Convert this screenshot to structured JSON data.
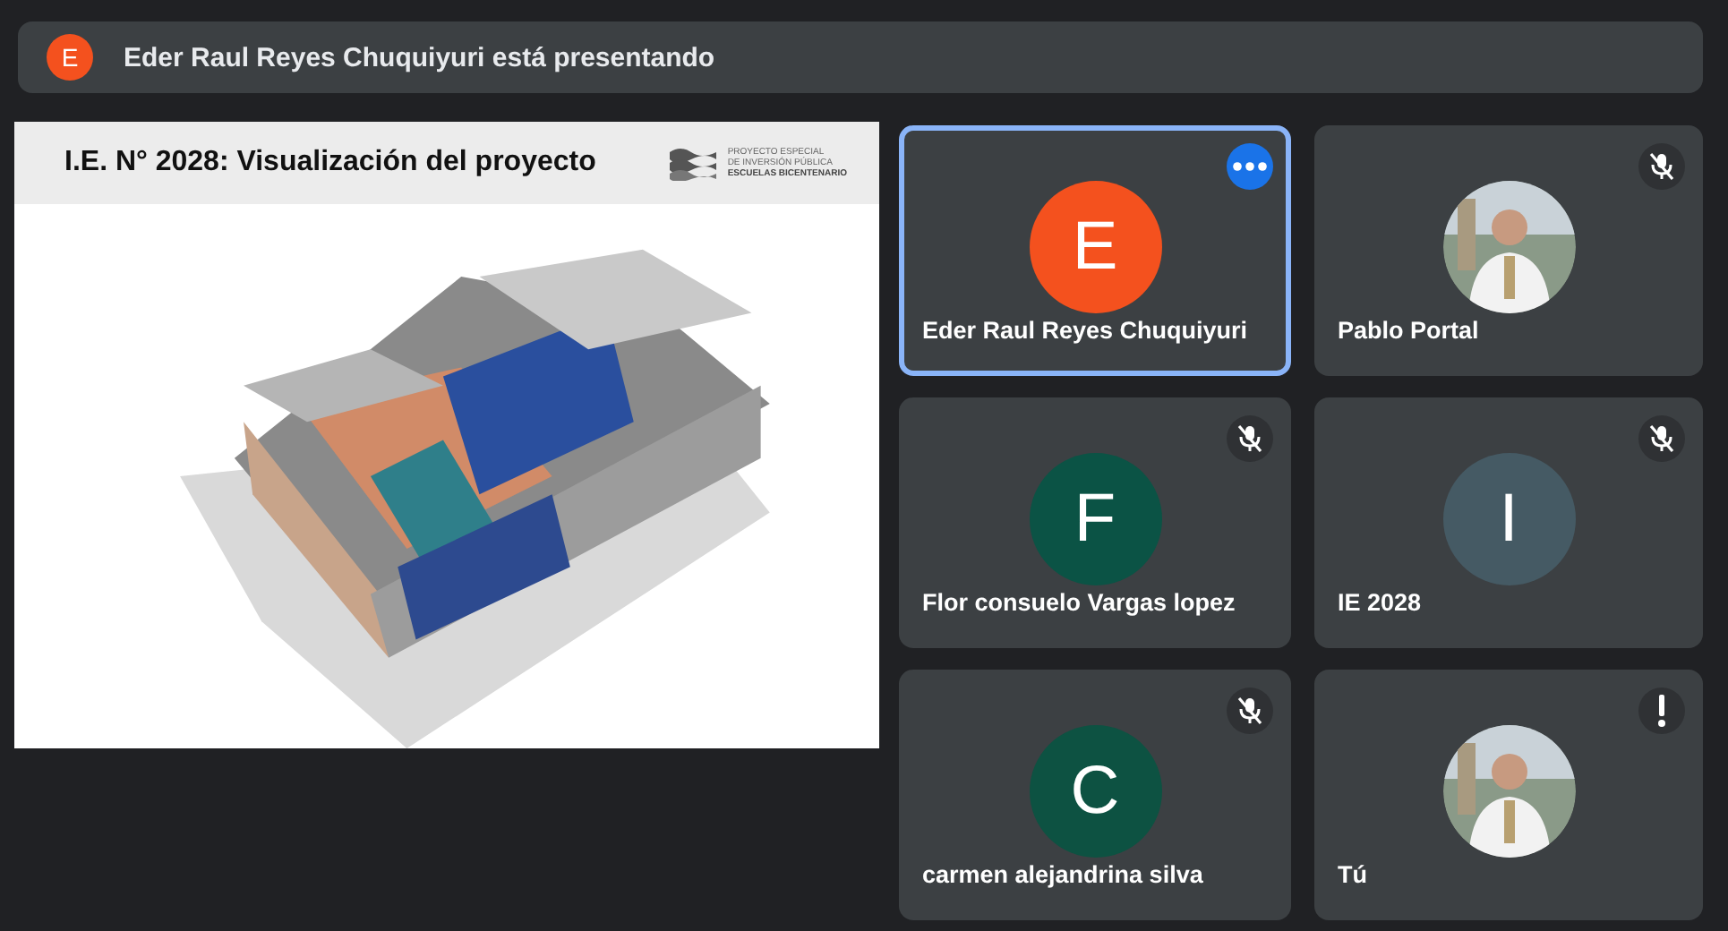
{
  "presenter_bar": {
    "initial": "E",
    "color": "#f4511e",
    "text": "Eder Raul Reyes Chuquiyuri está presentando"
  },
  "slide": {
    "title": "I.E. N° 2028: Visualización del proyecto",
    "logo_lines": [
      "PROYECTO ESPECIAL",
      "DE INVERSIÓN PÚBLICA",
      "ESCUELAS BICENTENARIO"
    ]
  },
  "participants": [
    {
      "name": "Eder Raul Reyes Chuquiyuri",
      "kind": "initial",
      "initial": "E",
      "color": "#f4511e",
      "indicator": {
        "kind": "more"
      },
      "selected": true
    },
    {
      "name": "Pablo Portal",
      "indicator": {
        "kind": "muted"
      },
      "selected": false
    },
    {
      "name": "Flor consuelo Vargas lopez",
      "kind": "initial",
      "initial": "F",
      "color": "#0b5345",
      "indicator": {
        "kind": "muted"
      },
      "selected": false
    },
    {
      "name": "IE 2028",
      "kind": "initial",
      "initial": "I",
      "color": "#455a64",
      "indicator": {
        "kind": "muted"
      },
      "selected": false
    },
    {
      "name": "carmen alejandrina silva",
      "kind": "initial",
      "initial": "C",
      "color": "#0d5242",
      "indicator": {
        "kind": "muted"
      },
      "selected": false
    },
    {
      "name": "Tú",
      "indicator": {
        "kind": "alert"
      },
      "selected": false
    }
  ]
}
